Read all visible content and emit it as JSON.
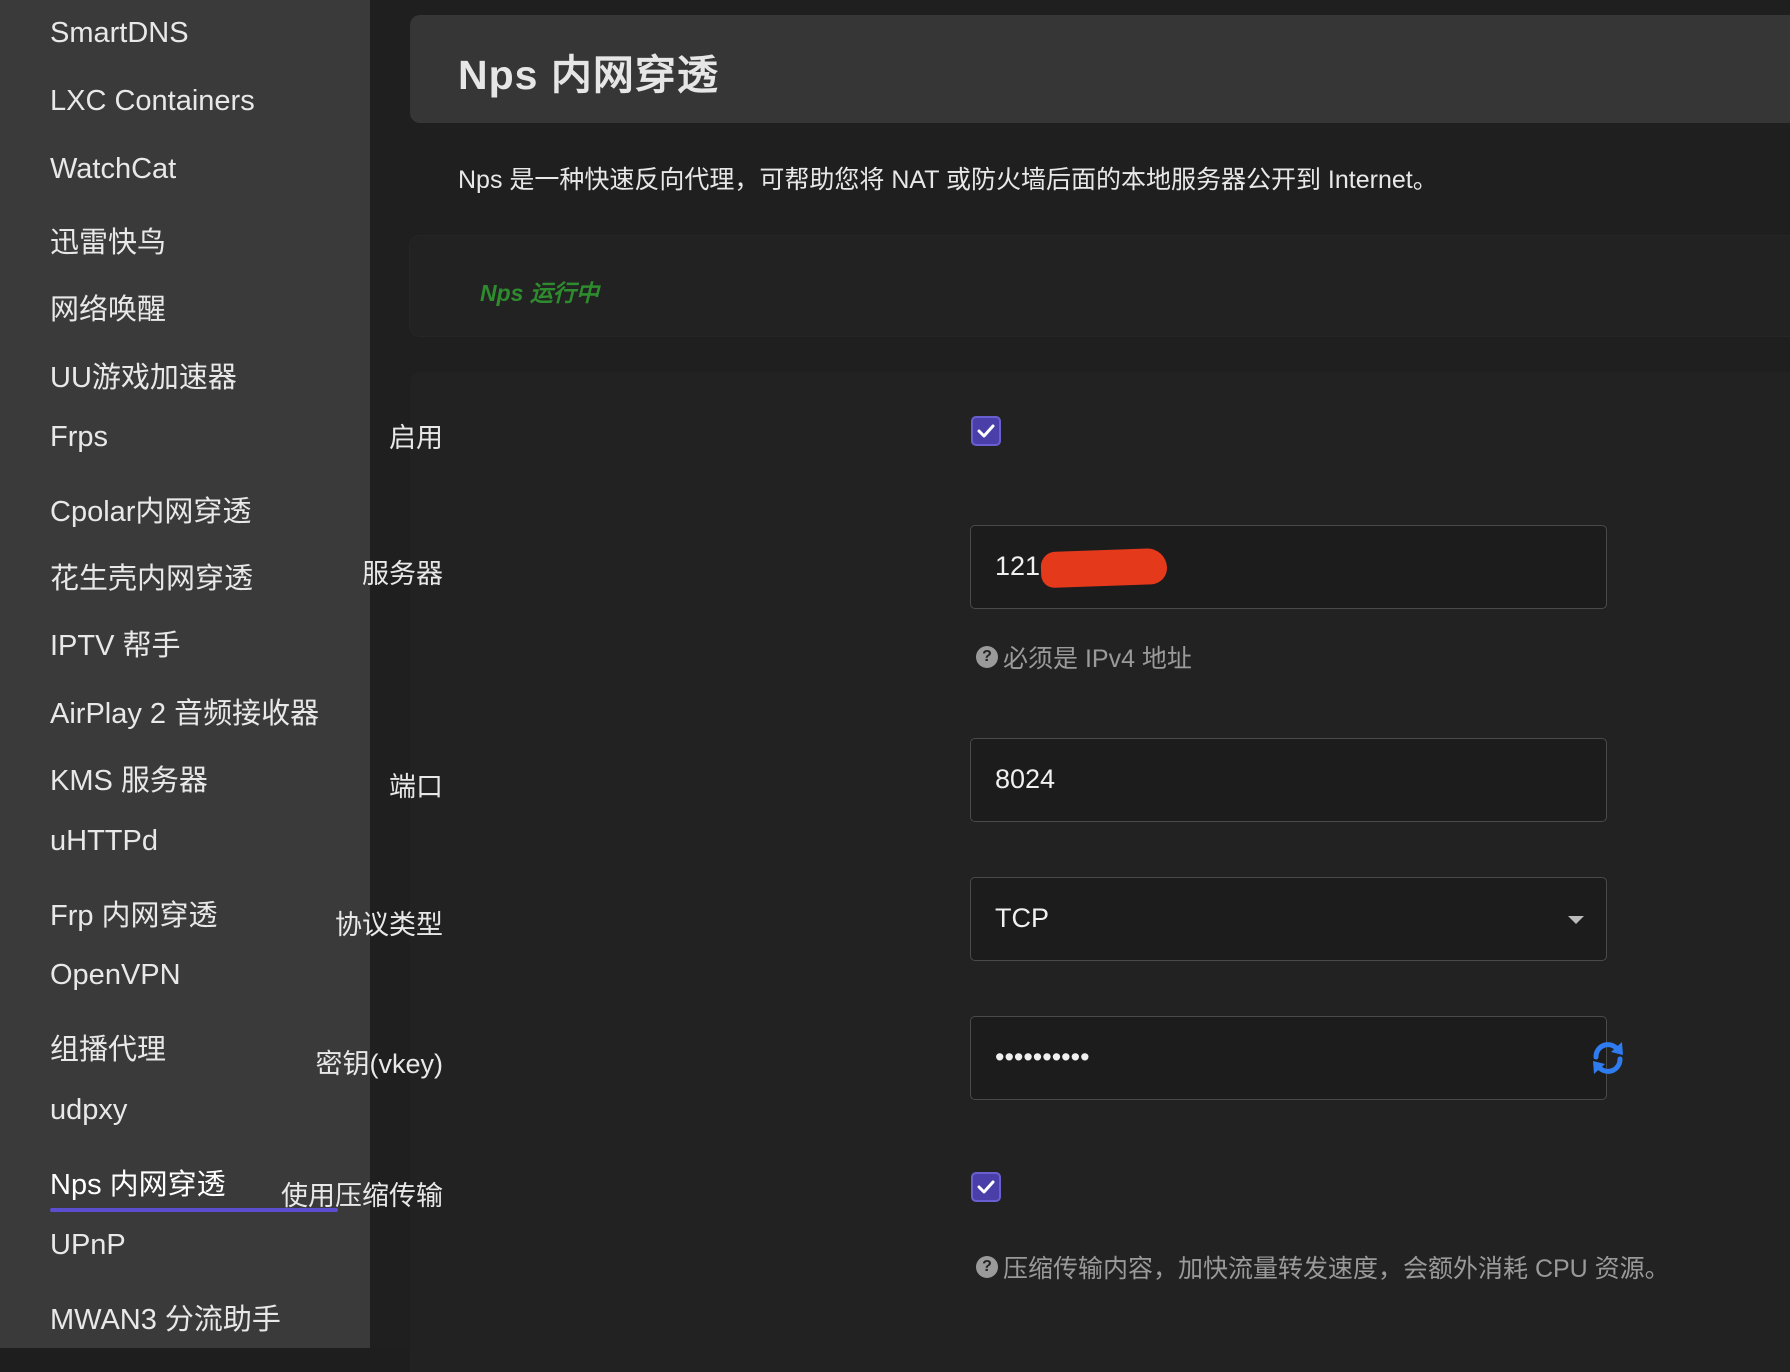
{
  "sidebar": {
    "items": [
      {
        "label": "SmartDNS"
      },
      {
        "label": "LXC Containers"
      },
      {
        "label": "WatchCat"
      },
      {
        "label": "迅雷快鸟"
      },
      {
        "label": "网络唤醒"
      },
      {
        "label": "UU游戏加速器"
      },
      {
        "label": "Frps"
      },
      {
        "label": "Cpolar内网穿透"
      },
      {
        "label": "花生壳内网穿透"
      },
      {
        "label": "IPTV 帮手"
      },
      {
        "label": "AirPlay 2 音频接收器"
      },
      {
        "label": "KMS 服务器"
      },
      {
        "label": "uHTTPd"
      },
      {
        "label": "Frp 内网穿透"
      },
      {
        "label": "OpenVPN"
      },
      {
        "label": "组播代理"
      },
      {
        "label": "udpxy"
      },
      {
        "label": "Nps 内网穿透"
      },
      {
        "label": "UPnP"
      },
      {
        "label": "MWAN3 分流助手"
      }
    ],
    "active_item": "Nps 内网穿透"
  },
  "header": {
    "title": "Nps 内网穿透",
    "description": "Nps 是一种快速反向代理，可帮助您将 NAT 或防火墙后面的本地服务器公开到 Internet。"
  },
  "status": {
    "text": "Nps 运行中",
    "color": "#2e8b2e"
  },
  "form": {
    "enable": {
      "label": "启用",
      "checked": true
    },
    "server": {
      "label": "服务器",
      "value": "121.",
      "hint": "必须是 IPv4 地址"
    },
    "port": {
      "label": "端口",
      "value": "8024"
    },
    "protocol": {
      "label": "协议类型",
      "value": "TCP"
    },
    "vkey": {
      "label": "密钥(vkey)",
      "value": "••••••••••"
    },
    "compress": {
      "label": "使用压缩传输",
      "checked": true,
      "hint": "压缩传输内容，加快流量转发速度，会额外消耗 CPU 资源。"
    }
  },
  "colors": {
    "accent": "#5b4fcf",
    "checkbox": "#4a3ea8",
    "refresh_icon": "#2f7cf0",
    "redaction": "#e5391c"
  },
  "icons": {
    "check": "check-icon",
    "help": "help-circle-icon",
    "refresh": "refresh-icon",
    "caret": "chevron-down-icon"
  }
}
